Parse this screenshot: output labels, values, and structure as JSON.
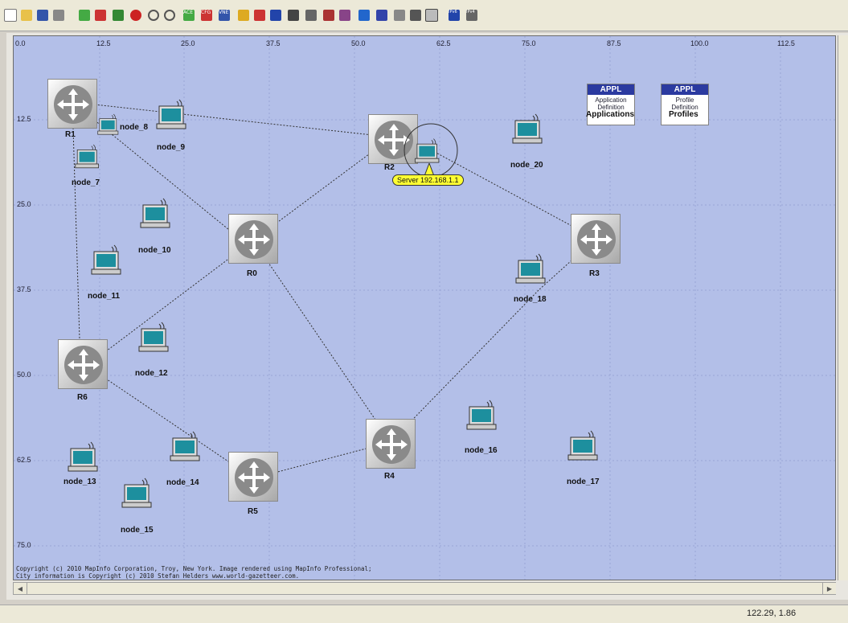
{
  "toolbar": {
    "buttons": [
      "new",
      "open",
      "save",
      "print",
      "import",
      "export",
      "config",
      "failure",
      "zoom-in",
      "zoom-out",
      "ace",
      "cfg",
      "vne",
      "objects",
      "topology",
      "node",
      "link",
      "model",
      "subnet",
      "run",
      "results",
      "statistics",
      "logs",
      "edit",
      "view",
      "ipv6",
      "ipv4"
    ],
    "labels": {
      "ace": "ACE",
      "cfg": "CFG",
      "vne": "VNE",
      "ipv6": "IPv6",
      "ipv4": "IPv4"
    }
  },
  "ruler": {
    "x_ticks": [
      "0.0",
      "12.5",
      "25.0",
      "37.5",
      "50.0",
      "62.5",
      "75.0",
      "87.5",
      "100.0",
      "112.5"
    ],
    "y_ticks": [
      "12.5",
      "25.0",
      "37.5",
      "50.0",
      "62.5",
      "75.0"
    ]
  },
  "routers": [
    "R1",
    "R2",
    "R0",
    "R3",
    "R6",
    "R4",
    "R5"
  ],
  "nodes": [
    "node_8",
    "node_9",
    "node_7",
    "node_10",
    "node_11",
    "node_12",
    "node_13",
    "node_14",
    "node_15",
    "node_16",
    "node_17",
    "node_18",
    "node_20"
  ],
  "applications": {
    "header": "APPL",
    "line1": "Application",
    "line2": "Definition",
    "label": "Applications"
  },
  "profiles": {
    "header": "APPL",
    "line1": "Profile",
    "line2": "Definition",
    "label": "Profiles"
  },
  "tooltip": "Server 192.168.1.1",
  "copyright": {
    "line1": "Copyright (c) 2010 MapInfo Corporation, Troy, New York. Image rendered using MapInfo Professional;",
    "line2": "City information is Copyright (c) 2010 Stefan Helders www.world-gazetteer.com."
  },
  "status": {
    "coordinates": "122.29, 1.86"
  },
  "colors": {
    "canvas": "#b3bfe8",
    "appl_header": "#2b3aa0",
    "tooltip": "#ffff33"
  }
}
